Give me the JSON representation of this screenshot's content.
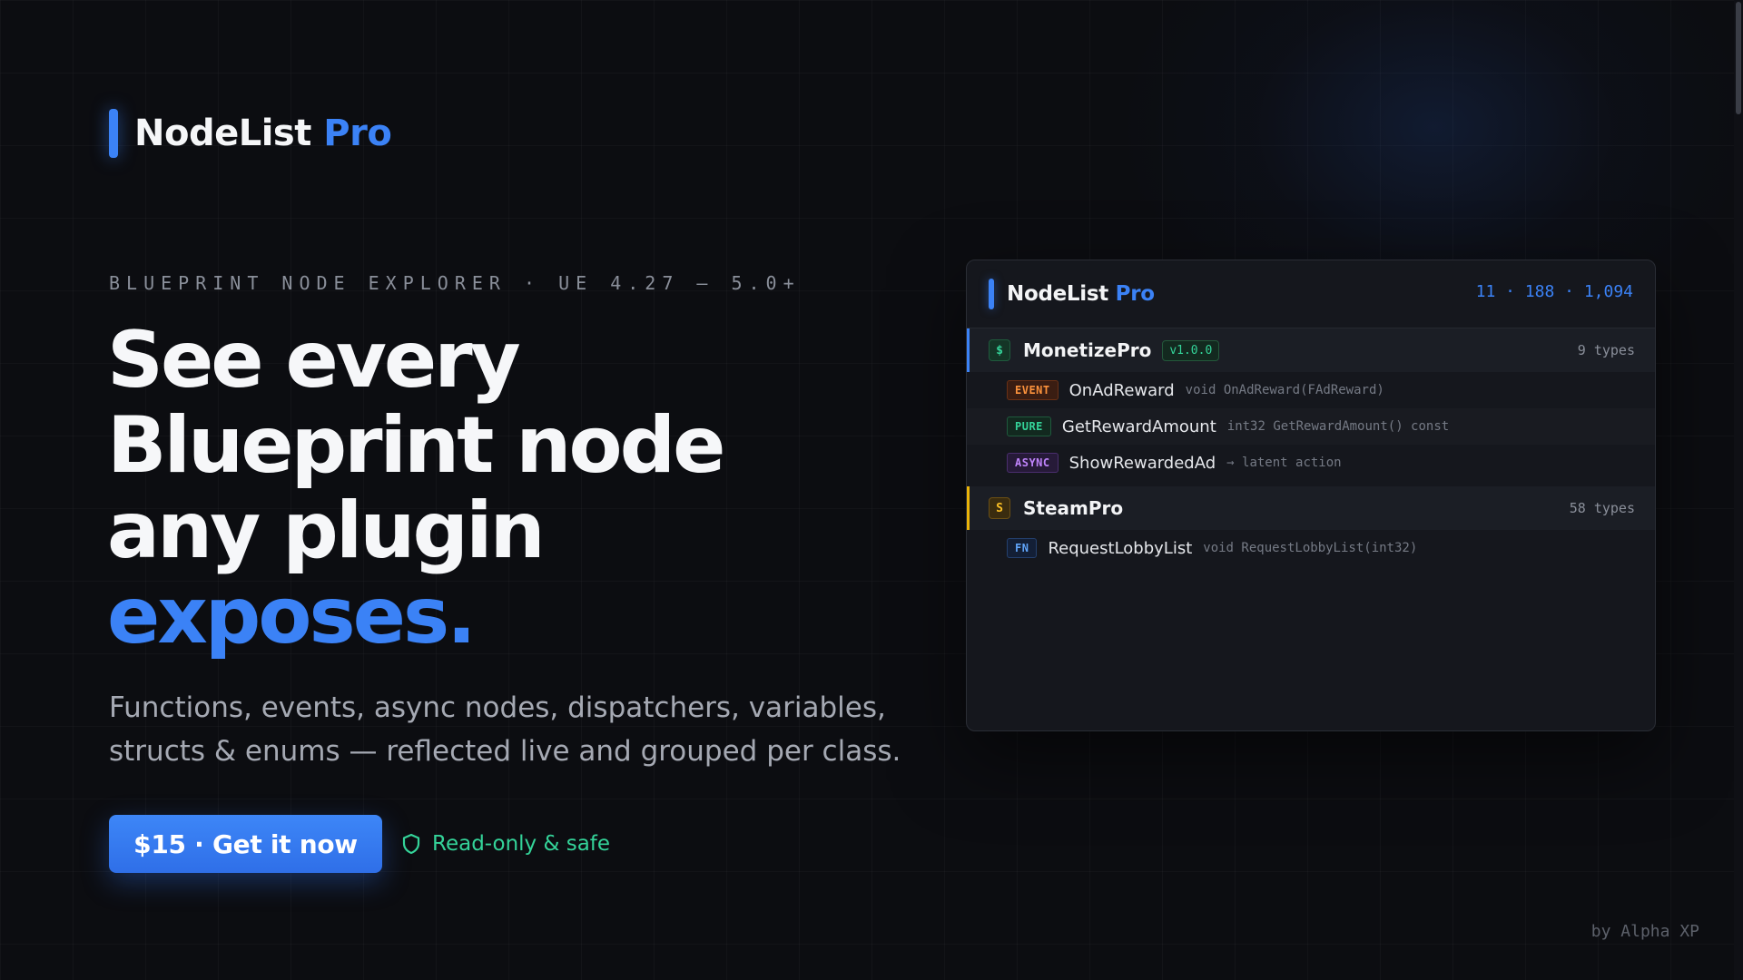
{
  "brand": {
    "name": "NodeList",
    "accent": "Pro"
  },
  "hero": {
    "eyebrow": "BLUEPRINT NODE EXPLORER · UE 4.27 – 5.0+",
    "headline": [
      "See every",
      "Blueprint node",
      "any plugin"
    ],
    "headline_accent": "exposes.",
    "subtext_lines": [
      "Functions, events, async nodes, dispatchers, variables,",
      "structs & enums — reflected live and grouped per class."
    ],
    "cta_label": "$15 · Get it now",
    "safe_label": "Read-only & safe",
    "safe_icon": "shield-icon"
  },
  "panel": {
    "title": "NodeList",
    "title_accent": "Pro",
    "stats": "11 · 188 · 1,094",
    "groups": [
      {
        "icon_letter": "$",
        "name": "MonetizePro",
        "version": "v1.0.0",
        "count": "9 types",
        "nodes": [
          {
            "kind": "EVENT",
            "name": "OnAdReward",
            "sig": "void OnAdReward(FAdReward)"
          },
          {
            "kind": "PURE",
            "name": "GetRewardAmount",
            "sig": "int32 GetRewardAmount() const"
          },
          {
            "kind": "ASYNC",
            "name": "ShowRewardedAd",
            "sig": "→ latent action"
          }
        ]
      },
      {
        "icon_letter": "S",
        "name": "SteamPro",
        "count": "58 types",
        "nodes": [
          {
            "kind": "FN",
            "name": "RequestLobbyList",
            "sig": "void RequestLobbyList(int32)"
          }
        ]
      }
    ]
  },
  "footer": {
    "byline": "by Alpha XP"
  },
  "colors": {
    "background": "#0c0d11",
    "accent": "#3b82f6",
    "safe_green": "#34d399",
    "event_orange": "#fb923c",
    "async_purple": "#c084fc",
    "steam_amber": "#eab308"
  }
}
